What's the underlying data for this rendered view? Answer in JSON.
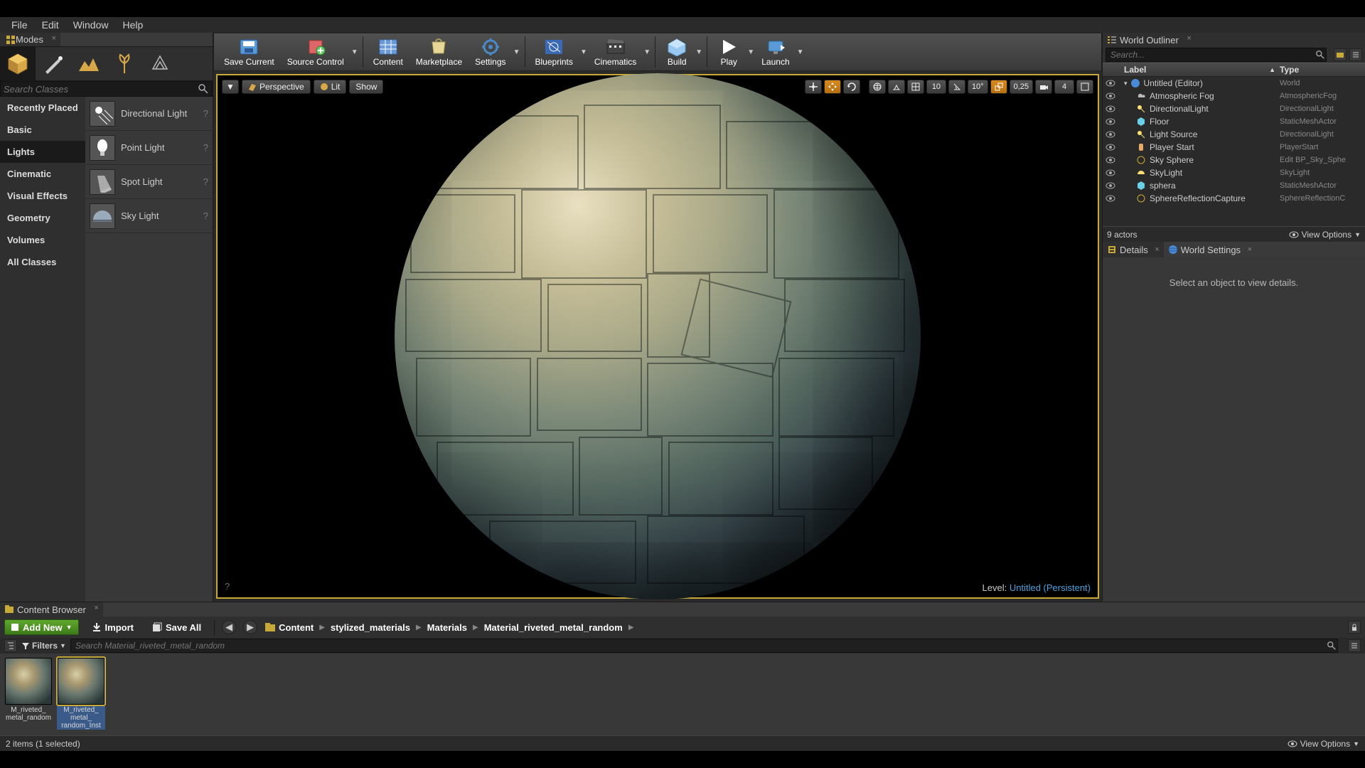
{
  "menu": {
    "items": [
      "File",
      "Edit",
      "Window",
      "Help"
    ]
  },
  "modes_panel": {
    "tab_label": "Modes",
    "search_placeholder": "Search Classes",
    "categories": [
      "Recently Placed",
      "Basic",
      "Lights",
      "Cinematic",
      "Visual Effects",
      "Geometry",
      "Volumes",
      "All Classes"
    ],
    "active_category_index": 2,
    "lights": [
      "Directional Light",
      "Point Light",
      "Spot Light",
      "Sky Light"
    ]
  },
  "toolbar": {
    "save_current": "Save Current",
    "source_control": "Source Control",
    "content": "Content",
    "marketplace": "Marketplace",
    "settings": "Settings",
    "blueprints": "Blueprints",
    "cinematics": "Cinematics",
    "build": "Build",
    "play": "Play",
    "launch": "Launch"
  },
  "viewport": {
    "perspective": "Perspective",
    "lit": "Lit",
    "show": "Show",
    "grid_snap": "10",
    "angle_snap": "10°",
    "scale_snap": "0,25",
    "cam_speed": "4",
    "level_label": "Level:",
    "level_value": "Untitled (Persistent)"
  },
  "outliner": {
    "tab_label": "World Outliner",
    "search_placeholder": "Search...",
    "col_label": "Label",
    "col_type": "Type",
    "rows": [
      {
        "indent": 0,
        "label": "Untitled (Editor)",
        "type": "World",
        "arrow": true
      },
      {
        "indent": 1,
        "label": "Atmospheric Fog",
        "type": "AtmosphericFog"
      },
      {
        "indent": 1,
        "label": "DirectionalLight",
        "type": "DirectionalLight"
      },
      {
        "indent": 1,
        "label": "Floor",
        "type": "StaticMeshActor"
      },
      {
        "indent": 1,
        "label": "Light Source",
        "type": "DirectionalLight"
      },
      {
        "indent": 1,
        "label": "Player Start",
        "type": "PlayerStart"
      },
      {
        "indent": 1,
        "label": "Sky Sphere",
        "type": "Edit BP_Sky_Sphe",
        "type_is_link": true
      },
      {
        "indent": 1,
        "label": "SkyLight",
        "type": "SkyLight"
      },
      {
        "indent": 1,
        "label": "sphera",
        "type": "StaticMeshActor"
      },
      {
        "indent": 1,
        "label": "SphereReflectionCapture",
        "type": "SphereReflectionC"
      }
    ],
    "actor_count": "9 actors",
    "view_options": "View Options"
  },
  "details": {
    "tab_details": "Details",
    "tab_world": "World Settings",
    "empty_msg": "Select an object to view details."
  },
  "content_browser": {
    "tab_label": "Content Browser",
    "add_new": "Add New",
    "import": "Import",
    "save_all": "Save All",
    "path": [
      "Content",
      "stylized_materials",
      "Materials",
      "Material_riveted_metal_random"
    ],
    "filters_label": "Filters",
    "search_placeholder": "Search Material_riveted_metal_random",
    "assets": [
      {
        "name": "M_riveted_metal_random"
      },
      {
        "name": "M_riveted_metal_random_Inst"
      }
    ],
    "selected_index": 1,
    "status": "2 items (1 selected)",
    "view_options": "View Options"
  }
}
